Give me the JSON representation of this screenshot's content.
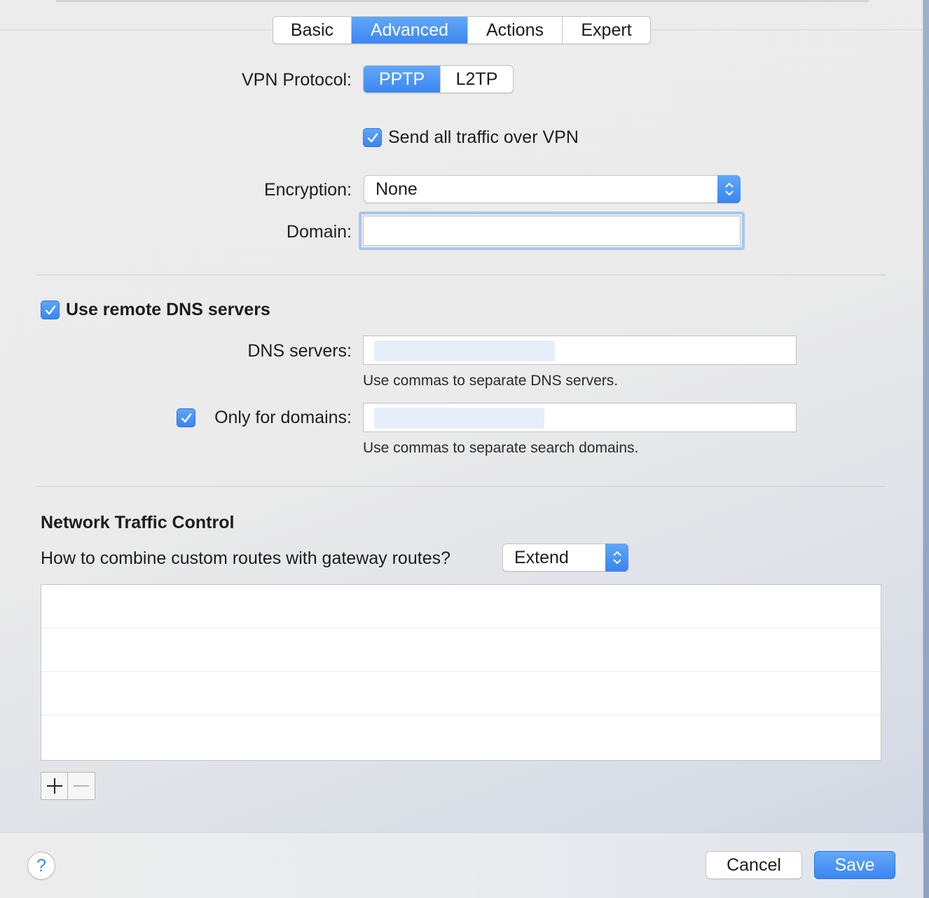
{
  "tabs": [
    {
      "label": "Basic",
      "active": false
    },
    {
      "label": "Advanced",
      "active": true
    },
    {
      "label": "Actions",
      "active": false
    },
    {
      "label": "Expert",
      "active": false
    }
  ],
  "vpn_protocol": {
    "label": "VPN Protocol:",
    "options": [
      {
        "label": "PPTP",
        "selected": true
      },
      {
        "label": "L2TP",
        "selected": false
      }
    ]
  },
  "send_all_traffic": {
    "label": "Send all traffic over VPN",
    "checked": true
  },
  "encryption": {
    "label": "Encryption:",
    "value": "None"
  },
  "domain": {
    "label": "Domain:",
    "value": ""
  },
  "dns": {
    "use_remote_label": "Use remote DNS servers",
    "use_remote_checked": true,
    "servers_label": "DNS servers:",
    "servers_value": "",
    "servers_hint": "Use commas to separate DNS servers.",
    "only_domains_label": "Only for domains:",
    "only_domains_checked": true,
    "only_domains_value": "",
    "only_domains_hint": "Use commas to separate search domains."
  },
  "traffic_control": {
    "title": "Network Traffic Control",
    "question": "How to combine custom routes with gateway routes?",
    "mode_value": "Extend",
    "routes": []
  },
  "footer": {
    "help": "?",
    "cancel_label": "Cancel",
    "save_label": "Save"
  },
  "colors": {
    "accent": "#3b86f2",
    "accent_light": "#62a8f8",
    "background": "#ececec"
  }
}
